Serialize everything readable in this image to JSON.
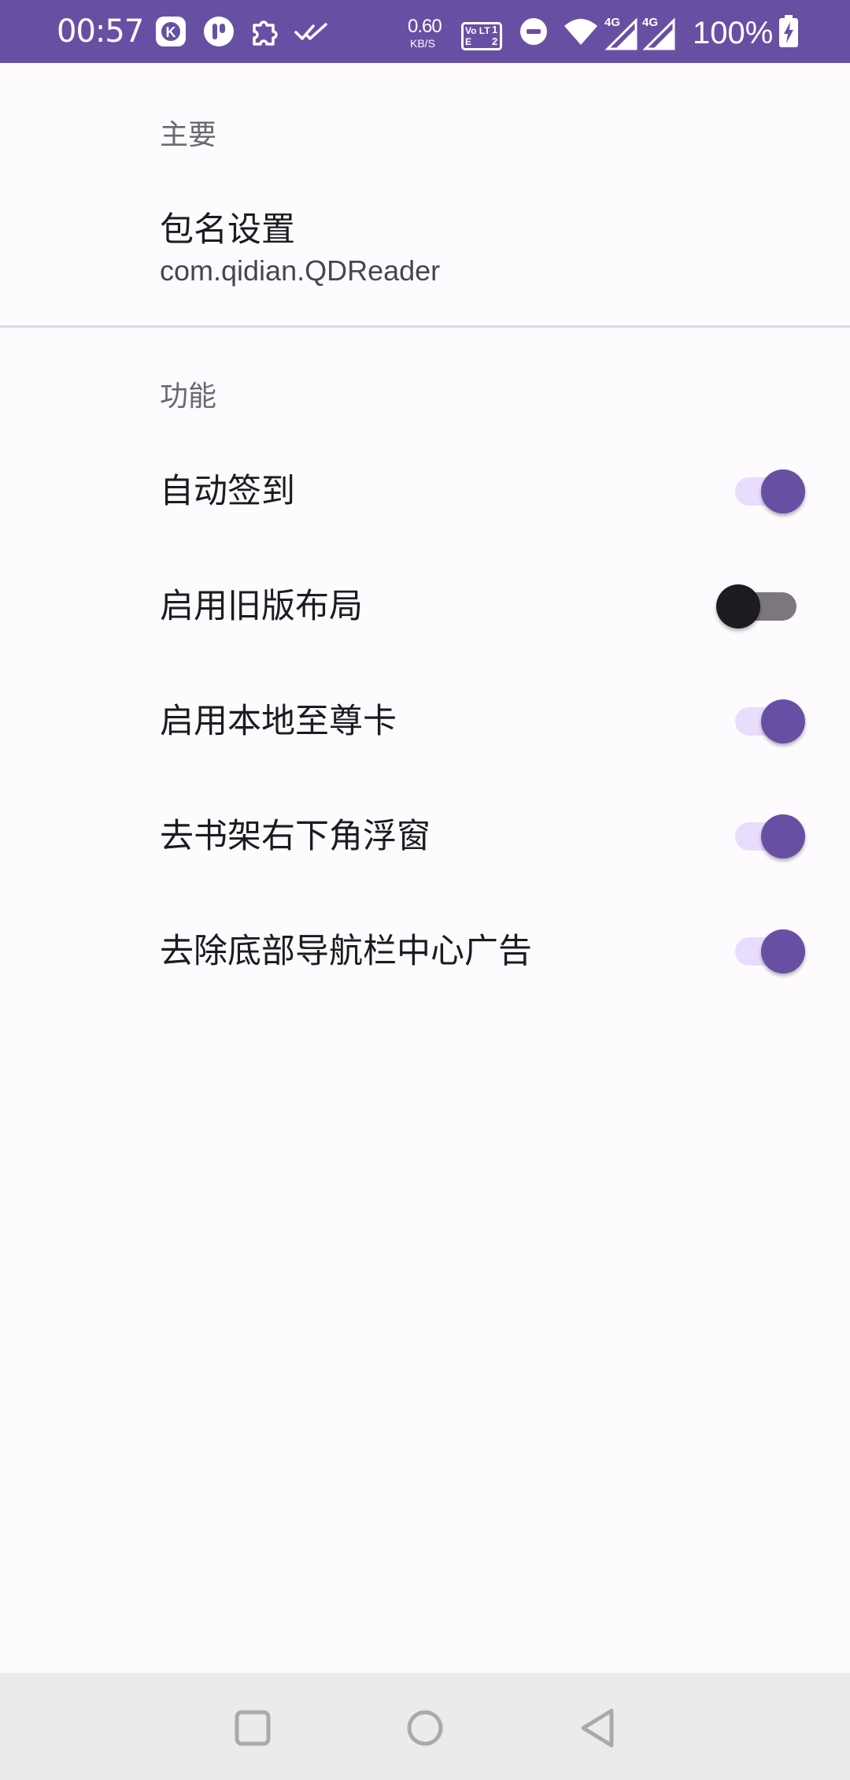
{
  "status_bar": {
    "time": "00:57",
    "net_speed_value": "0.60",
    "net_speed_unit": "KB/S",
    "volte_label": "Vo LTE",
    "sim1_label": "1",
    "sim2_label": "2",
    "signal1_label": "4G",
    "signal2_label": "4G",
    "battery_percent": "100%",
    "accent_color": "#6750a4"
  },
  "sections": {
    "main": {
      "header": "主要",
      "package_setting": {
        "title": "包名设置",
        "summary": "com.qidian.QDReader"
      }
    },
    "features": {
      "header": "功能",
      "items": [
        {
          "label": "自动签到",
          "enabled": true
        },
        {
          "label": "启用旧版布局",
          "enabled": false
        },
        {
          "label": "启用本地至尊卡",
          "enabled": true
        },
        {
          "label": "去书架右下角浮窗",
          "enabled": true
        },
        {
          "label": "去除底部导航栏中心广告",
          "enabled": true
        }
      ]
    }
  },
  "navigation_bar": {
    "buttons": [
      "recents-icon",
      "home-icon",
      "back-icon"
    ]
  }
}
